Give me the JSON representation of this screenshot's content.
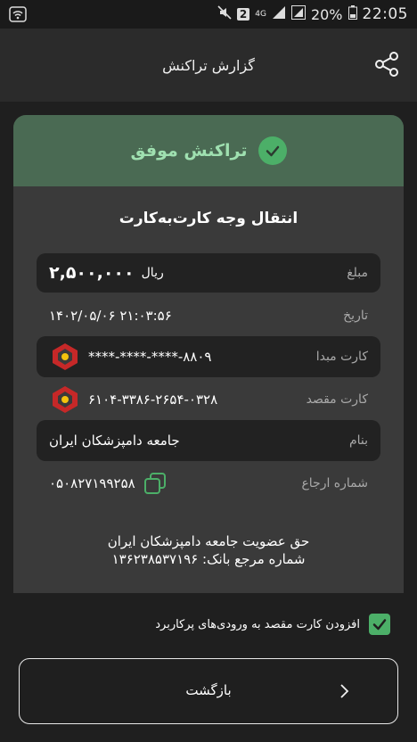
{
  "status_bar": {
    "time": "22:05",
    "battery": "20%",
    "network": "4G",
    "sim_badge": "2"
  },
  "header": {
    "title": "گزارش تراکنش",
    "share_icon": "share-icon"
  },
  "receipt": {
    "status_text": "تراکنش موفق",
    "transaction_type": "انتقال وجه کارت‌به‌کارت",
    "amount_label": "مبلغ",
    "amount_value": "۲,۵۰۰,۰۰۰",
    "amount_unit": "ریال",
    "date_label": "تاریخ",
    "date_value": "۱۴۰۲/۰۵/۰۶ ۲۱:۰۳:۵۶",
    "source_card_label": "کارت مبدا",
    "source_card_value": "****-****-****-۸۸۰۹",
    "dest_card_label": "کارت مقصد",
    "dest_card_value": "۶۱۰۴-۳۳۸۶-۲۶۵۴-۰۳۲۸",
    "name_label": "بنام",
    "name_value": "جامعه دامپزشکان ایران",
    "ref_label": "شماره ارجاع",
    "ref_value": "۰۵۰۸۲۷۱۹۹۲۵۸",
    "description_line1": "حق عضویت جامعه دامپزشکان ایران",
    "description_line2": "شماره مرجع بانک: ۱۳۶۲۳۸۵۳۷۱۹۶"
  },
  "add_card_checkbox": {
    "label": "افزودن کارت مقصد به ورودی‌های پرکاربرد",
    "checked": true
  },
  "back_button": {
    "label": "بازگشت"
  },
  "colors": {
    "success_bg": "#4a6a53",
    "success_text": "#9fe0b0",
    "accent_green": "#4caf68",
    "bank_red": "#c62828"
  }
}
